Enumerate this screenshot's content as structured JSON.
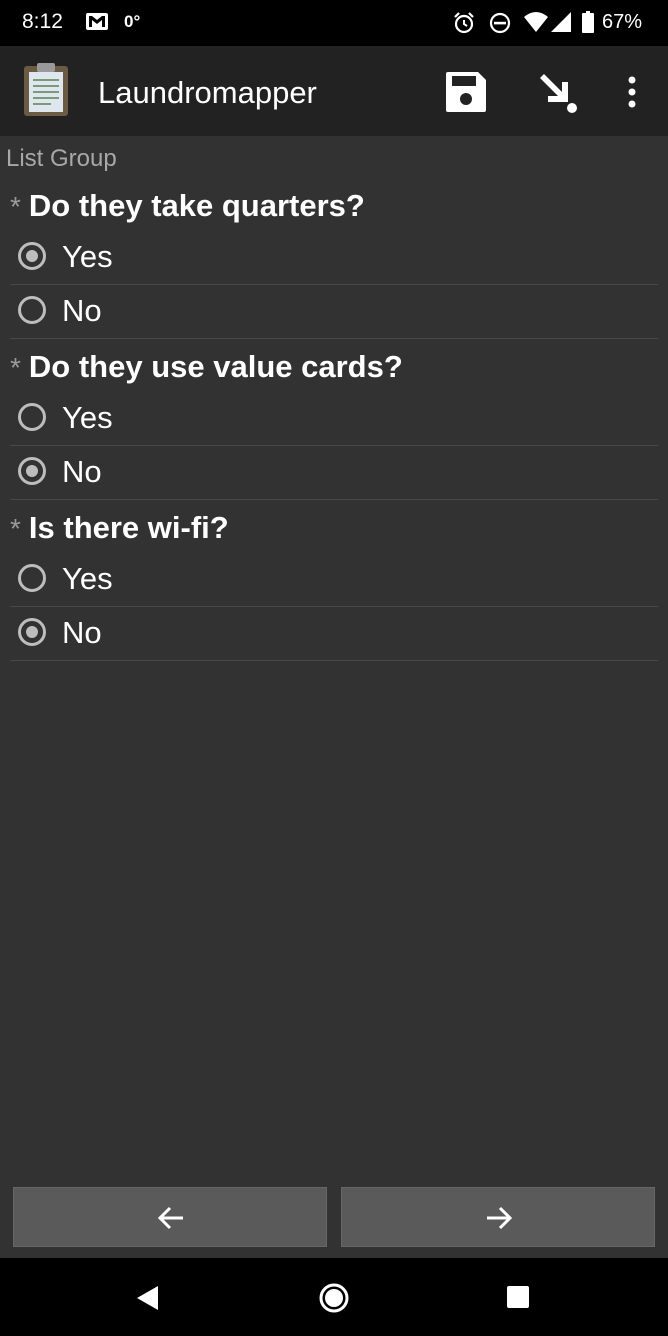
{
  "status_bar": {
    "time": "8:12",
    "temperature": "0°",
    "battery": "67%",
    "icons": [
      "mail-icon",
      "alarm-icon",
      "do-not-disturb-icon",
      "wifi-icon",
      "signal-icon",
      "battery-icon"
    ]
  },
  "app_bar": {
    "title": "Laundromapper",
    "actions": [
      "save-icon",
      "jump-to-icon",
      "more-options-icon"
    ]
  },
  "group_label": "List Group",
  "questions": [
    {
      "required_marker": "*",
      "text": "Do they take quarters?",
      "options": [
        {
          "label": "Yes",
          "selected": true
        },
        {
          "label": "No",
          "selected": false
        }
      ]
    },
    {
      "required_marker": "*",
      "text": "Do they use value cards?",
      "options": [
        {
          "label": "Yes",
          "selected": false
        },
        {
          "label": "No",
          "selected": true
        }
      ]
    },
    {
      "required_marker": "*",
      "text": "Is there wi-fi?",
      "options": [
        {
          "label": "Yes",
          "selected": false
        },
        {
          "label": "No",
          "selected": true
        }
      ]
    }
  ],
  "navigation": {
    "prev_icon": "arrow-left-icon",
    "next_icon": "arrow-right-icon"
  },
  "colors": {
    "background": "#323232",
    "app_bar": "#222222",
    "radio": "#bdbdbd"
  }
}
